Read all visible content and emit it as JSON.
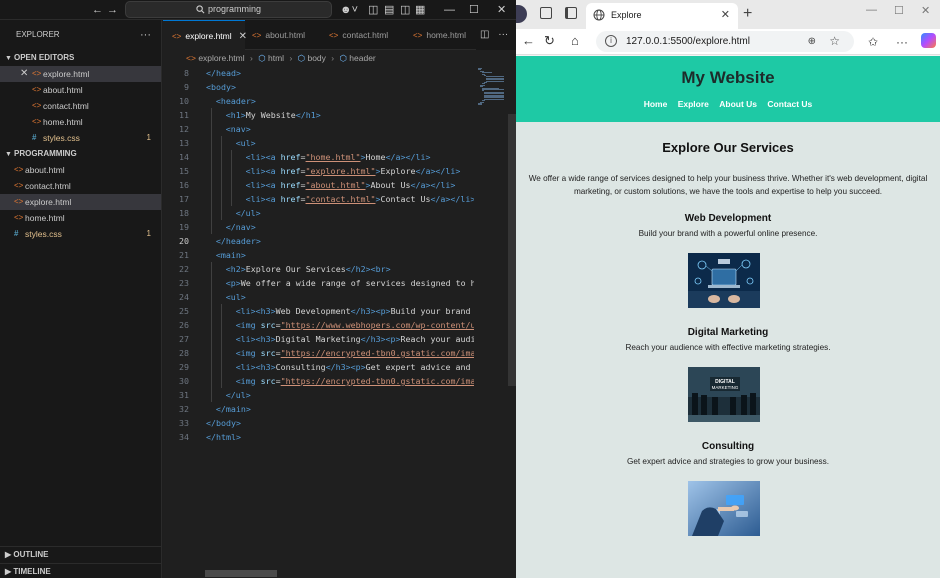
{
  "vscode": {
    "command_center": "programming",
    "explorer_title": "EXPLORER",
    "open_editors_label": "OPEN EDITORS",
    "open_editors": [
      {
        "name": "explore.html",
        "type": "html",
        "active": true,
        "closable": true
      },
      {
        "name": "about.html",
        "type": "html"
      },
      {
        "name": "contact.html",
        "type": "html"
      },
      {
        "name": "home.html",
        "type": "html"
      },
      {
        "name": "styles.css",
        "type": "css",
        "badge": "1",
        "modified": true
      }
    ],
    "workspace_label": "PROGRAMMING",
    "workspace_files": [
      {
        "name": "about.html",
        "type": "html"
      },
      {
        "name": "contact.html",
        "type": "html"
      },
      {
        "name": "explore.html",
        "type": "html",
        "active": true
      },
      {
        "name": "home.html",
        "type": "html"
      },
      {
        "name": "styles.css",
        "type": "css",
        "badge": "1",
        "modified": true
      }
    ],
    "outline_label": "OUTLINE",
    "timeline_label": "TIMELINE",
    "tabs": [
      {
        "label": "explore.html",
        "active": true
      },
      {
        "label": "about.html"
      },
      {
        "label": "contact.html"
      },
      {
        "label": "home.html"
      }
    ],
    "breadcrumb": [
      "explore.html",
      "html",
      "body",
      "header"
    ],
    "current_line": 20,
    "code_lines": [
      {
        "n": 8,
        "indent": 0,
        "parts": [
          [
            "tag",
            "</head>"
          ]
        ]
      },
      {
        "n": 9,
        "indent": 0,
        "parts": [
          [
            "tag",
            "<body>"
          ]
        ]
      },
      {
        "n": 10,
        "indent": 1,
        "parts": [
          [
            "tag",
            "<header>"
          ]
        ]
      },
      {
        "n": 11,
        "indent": 2,
        "parts": [
          [
            "tag",
            "<h1>"
          ],
          [
            "txt",
            "My Website"
          ],
          [
            "tag",
            "</h1>"
          ]
        ]
      },
      {
        "n": 12,
        "indent": 2,
        "parts": [
          [
            "tag",
            "<nav>"
          ]
        ]
      },
      {
        "n": 13,
        "indent": 3,
        "parts": [
          [
            "tag",
            "<ul>"
          ]
        ]
      },
      {
        "n": 14,
        "indent": 4,
        "parts": [
          [
            "tag",
            "<li><a "
          ],
          [
            "attr",
            "href"
          ],
          [
            "txt",
            "="
          ],
          [
            "str",
            "\"home.html\""
          ],
          [
            "tag",
            ">"
          ],
          [
            "txt",
            "Home"
          ],
          [
            "tag",
            "</a></li>"
          ]
        ]
      },
      {
        "n": 15,
        "indent": 4,
        "parts": [
          [
            "tag",
            "<li><a "
          ],
          [
            "attr",
            "href"
          ],
          [
            "txt",
            "="
          ],
          [
            "str",
            "\"explore.html\""
          ],
          [
            "tag",
            ">"
          ],
          [
            "txt",
            "Explore"
          ],
          [
            "tag",
            "</a></li>"
          ]
        ]
      },
      {
        "n": 16,
        "indent": 4,
        "parts": [
          [
            "tag",
            "<li><a "
          ],
          [
            "attr",
            "href"
          ],
          [
            "txt",
            "="
          ],
          [
            "str",
            "\"about.html\""
          ],
          [
            "tag",
            ">"
          ],
          [
            "txt",
            "About Us"
          ],
          [
            "tag",
            "</a></li>"
          ]
        ]
      },
      {
        "n": 17,
        "indent": 4,
        "parts": [
          [
            "tag",
            "<li><a "
          ],
          [
            "attr",
            "href"
          ],
          [
            "txt",
            "="
          ],
          [
            "str",
            "\"contact.html\""
          ],
          [
            "tag",
            ">"
          ],
          [
            "txt",
            "Contact Us"
          ],
          [
            "tag",
            "</a></li>"
          ]
        ]
      },
      {
        "n": 18,
        "indent": 3,
        "parts": [
          [
            "tag",
            "</ul>"
          ]
        ]
      },
      {
        "n": 19,
        "indent": 2,
        "parts": [
          [
            "tag",
            "</nav>"
          ]
        ]
      },
      {
        "n": 20,
        "indent": 1,
        "parts": [
          [
            "tag",
            "</header>"
          ]
        ]
      },
      {
        "n": 21,
        "indent": 1,
        "parts": [
          [
            "tag",
            "<main>"
          ]
        ]
      },
      {
        "n": 22,
        "indent": 2,
        "parts": [
          [
            "tag",
            "<h2>"
          ],
          [
            "txt",
            "Explore Our Services"
          ],
          [
            "tag",
            "</h2><br>"
          ]
        ]
      },
      {
        "n": 23,
        "indent": 2,
        "parts": [
          [
            "tag",
            "<p>"
          ],
          [
            "txt",
            "We offer a wide range of services designed to h"
          ]
        ]
      },
      {
        "n": 24,
        "indent": 2,
        "parts": [
          [
            "tag",
            "<ul>"
          ]
        ]
      },
      {
        "n": 25,
        "indent": 3,
        "parts": [
          [
            "tag",
            "<li><h3>"
          ],
          [
            "txt",
            "Web Development"
          ],
          [
            "tag",
            "</h3><p>"
          ],
          [
            "txt",
            "Build your brand w"
          ]
        ]
      },
      {
        "n": 26,
        "indent": 3,
        "parts": [
          [
            "tag",
            "<img "
          ],
          [
            "attr",
            "src"
          ],
          [
            "txt",
            "="
          ],
          [
            "str",
            "\"https://www.webhopers.com/wp-content/u"
          ]
        ]
      },
      {
        "n": 27,
        "indent": 3,
        "parts": [
          [
            "tag",
            "<li><h3>"
          ],
          [
            "txt",
            "Digital Marketing"
          ],
          [
            "tag",
            "</h3><p>"
          ],
          [
            "txt",
            "Reach your audi"
          ]
        ]
      },
      {
        "n": 28,
        "indent": 3,
        "parts": [
          [
            "tag",
            "<img "
          ],
          [
            "attr",
            "src"
          ],
          [
            "txt",
            "="
          ],
          [
            "str",
            "\"https://encrypted-tbn0.gstatic.com/ima"
          ]
        ]
      },
      {
        "n": 29,
        "indent": 3,
        "parts": [
          [
            "tag",
            "<li><h3>"
          ],
          [
            "txt",
            "Consulting"
          ],
          [
            "tag",
            "</h3><p>"
          ],
          [
            "txt",
            "Get expert advice and "
          ]
        ]
      },
      {
        "n": 30,
        "indent": 3,
        "parts": [
          [
            "tag",
            "<img "
          ],
          [
            "attr",
            "src"
          ],
          [
            "txt",
            "="
          ],
          [
            "str",
            "\"https://encrypted-tbn0.gstatic.com/ima"
          ]
        ]
      },
      {
        "n": 31,
        "indent": 2,
        "parts": [
          [
            "tag",
            "</ul>"
          ]
        ]
      },
      {
        "n": 32,
        "indent": 1,
        "parts": [
          [
            "tag",
            "</main>"
          ]
        ]
      },
      {
        "n": 33,
        "indent": 0,
        "parts": [
          [
            "tag",
            "</body>"
          ]
        ]
      },
      {
        "n": 34,
        "indent": 0,
        "parts": [
          [
            "tag",
            "</html>"
          ]
        ]
      }
    ]
  },
  "browser": {
    "tab_title": "Explore",
    "url": "127.0.0.1:5500/explore.html",
    "page": {
      "site_title": "My Website",
      "nav": [
        "Home",
        "Explore",
        "About Us",
        "Contact Us"
      ],
      "services_heading": "Explore Our Services",
      "intro": "We offer a wide range of services designed to help your business thrive. Whether it's web development, digital marketing, or custom solutions, we have the tools and expertise to help you succeed.",
      "services": [
        {
          "title": "Web Development",
          "desc": "Build your brand with a powerful online presence.",
          "image": "web-development-image"
        },
        {
          "title": "Digital Marketing",
          "desc": "Reach your audience with effective marketing strategies.",
          "image": "digital-marketing-image",
          "image_text": "DIGITAL MARKETING"
        },
        {
          "title": "Consulting",
          "desc": "Get expert advice and strategies to grow your business.",
          "image": "consulting-image"
        }
      ]
    }
  },
  "colors": {
    "vscode_bg": "#1f1f1f",
    "accent": "#0078d4",
    "header_teal": "#1ec9a5",
    "page_bg": "#dde6e4"
  }
}
